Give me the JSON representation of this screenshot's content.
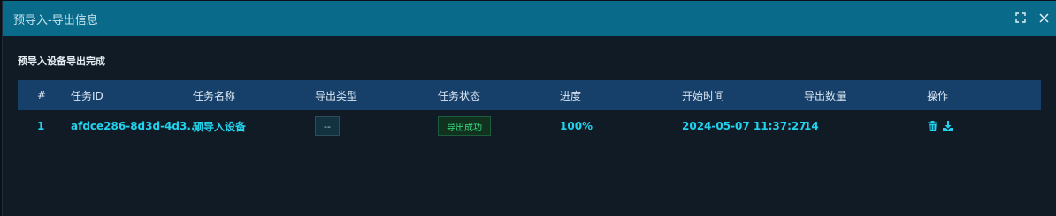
{
  "dialog": {
    "title": "预导入-导出信息",
    "message": "预导入设备导出完成"
  },
  "table": {
    "headers": {
      "num": "#",
      "id": "任务ID",
      "name": "任务名称",
      "type": "导出类型",
      "status": "任务状态",
      "progress": "进度",
      "start_time": "开始时间",
      "count": "导出数量",
      "ops": "操作"
    },
    "rows": [
      {
        "num": "1",
        "id": "afdce286-8d3d-4d3...",
        "name": "预导入设备",
        "type": "--",
        "status": "导出成功",
        "progress": "100%",
        "start_time": "2024-05-07 11:37:27",
        "count": "14"
      }
    ]
  },
  "colors": {
    "titlebar": "#0a6a8a",
    "table_header": "#163f6a",
    "cell_text": "#22d3ee",
    "success": "#3ddc84"
  },
  "icons": [
    "maximize-icon",
    "close-icon",
    "delete-icon",
    "download-icon"
  ]
}
